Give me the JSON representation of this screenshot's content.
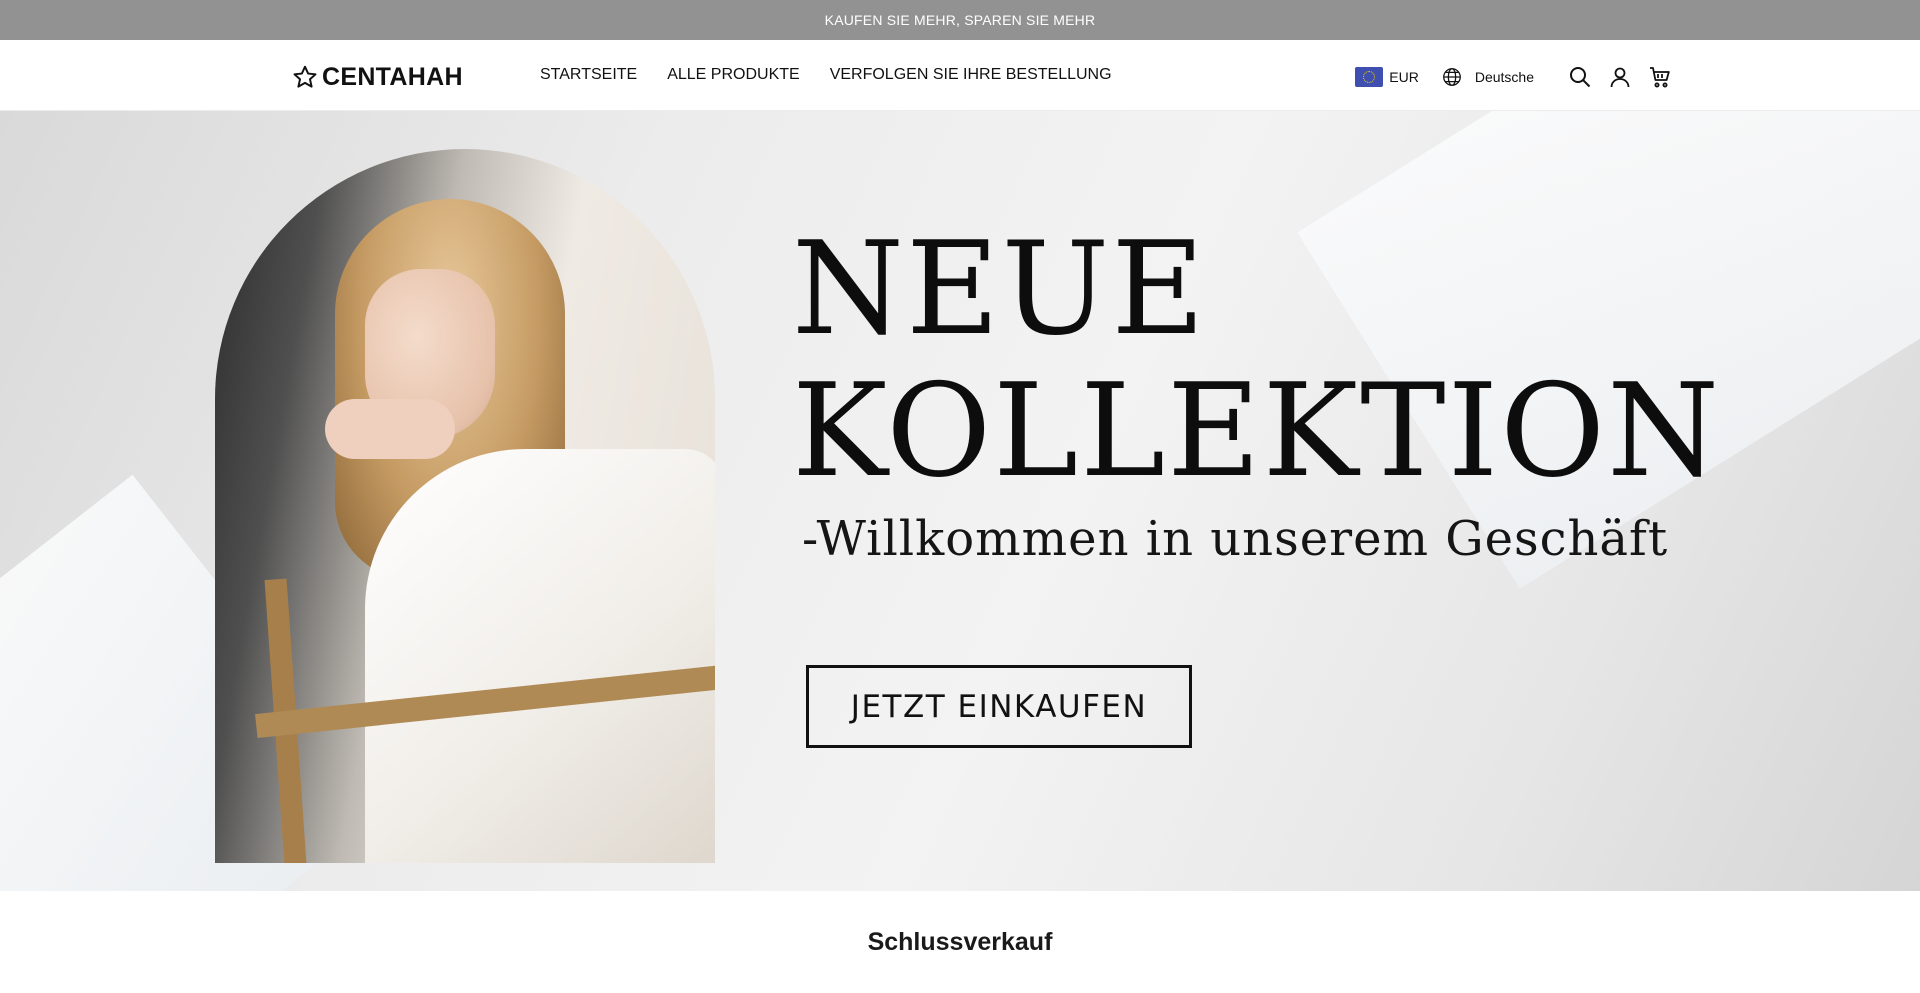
{
  "announcement": {
    "text": "⁠KAUFEN SIE MEHR, SPAREN SIE MEHR⁠"
  },
  "header": {
    "logo_text": "CENTAHAH",
    "nav": [
      {
        "label": "STARTSEITE"
      },
      {
        "label": "ALLE PRODUKTE"
      },
      {
        "label": "VERFOLGEN SIE IHRE BESTELLUNG"
      }
    ],
    "currency": "EUR",
    "language": "Deutsche",
    "icons": [
      "star-logo-icon",
      "eu-flag-icon",
      "globe-icon",
      "search-icon",
      "account-icon",
      "cart-icon"
    ]
  },
  "hero": {
    "title_line1": "NEUE",
    "title_line2": "KOLLEKTION",
    "subtitle": "-Willkommen in unserem Geschäft",
    "cta_label": "JETZT EINKAUFEN"
  },
  "sections": {
    "title": "Schlussverkauf"
  },
  "colors": {
    "announcement_bg": "#929292",
    "text": "#111111",
    "flag_blue": "#3e4fb0"
  }
}
